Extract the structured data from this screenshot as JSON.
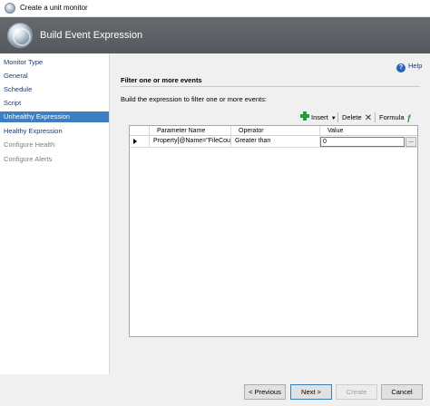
{
  "window": {
    "title": "Create a unit monitor"
  },
  "banner": {
    "heading": "Build Event Expression"
  },
  "nav": {
    "items": [
      {
        "label": "Monitor Type"
      },
      {
        "label": "General"
      },
      {
        "label": "Schedule"
      },
      {
        "label": "Script"
      },
      {
        "label": "Unhealthy Expression"
      },
      {
        "label": "Healthy Expression"
      },
      {
        "label": "Configure Health"
      },
      {
        "label": "Configure Alerts"
      }
    ],
    "selected": "Unhealthy Expression"
  },
  "content": {
    "help_label": "Help",
    "section_title": "Filter one or more events",
    "instruction": "Build the expression to filter one or more events:",
    "toolbar": {
      "insert_label": "Insert",
      "delete_label": "Delete",
      "formula_label": "Formula"
    },
    "grid": {
      "columns": [
        "Parameter Name",
        "Operator",
        "Value"
      ],
      "rows": [
        {
          "parameter": "Property[@Name=\"FileCoun...",
          "operator": "Greater than",
          "value": "0",
          "ellipsis": "..."
        }
      ]
    }
  },
  "footer": {
    "previous_label": "< Previous",
    "next_label": "Next >",
    "create_label": "Create",
    "cancel_label": "Cancel"
  },
  "colors": {
    "selection": "#3d7fc1",
    "banner": "#5f6368",
    "link": "#1b3d73"
  }
}
